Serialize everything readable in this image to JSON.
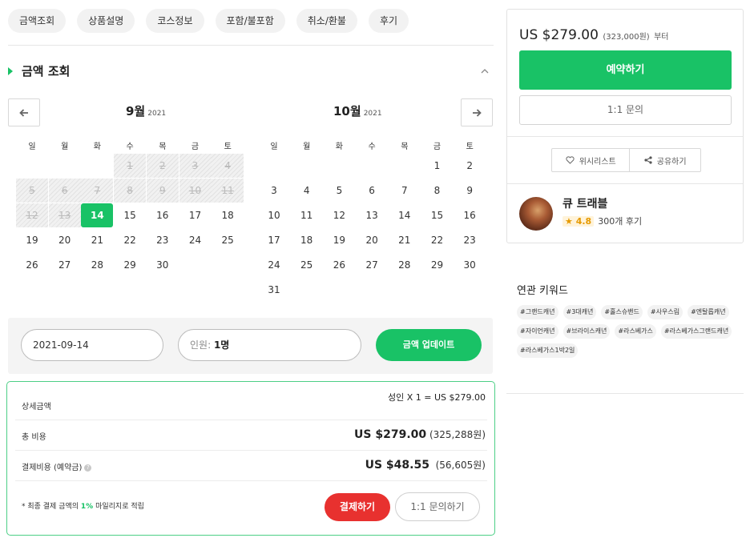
{
  "tabs": [
    "금액조회",
    "상품설명",
    "코스정보",
    "포함/불포함",
    "취소/환불",
    "후기"
  ],
  "section": {
    "title": "금액 조회"
  },
  "calendar": {
    "weekdays": [
      "일",
      "월",
      "화",
      "수",
      "목",
      "금",
      "토"
    ],
    "months": [
      {
        "name": "9월",
        "year": "2021",
        "weeks": [
          [
            "",
            "",
            "",
            "1",
            "2",
            "3",
            "4"
          ],
          [
            "5",
            "6",
            "7",
            "8",
            "9",
            "10",
            "11"
          ],
          [
            "12",
            "13",
            "14",
            "15",
            "16",
            "17",
            "18"
          ],
          [
            "19",
            "20",
            "21",
            "22",
            "23",
            "24",
            "25"
          ],
          [
            "26",
            "27",
            "28",
            "29",
            "30",
            "",
            ""
          ]
        ],
        "past_days": [
          "1",
          "2",
          "3",
          "4",
          "5",
          "6",
          "7",
          "8",
          "9",
          "10",
          "11",
          "12",
          "13"
        ],
        "selected_day": "14"
      },
      {
        "name": "10월",
        "year": "2021",
        "weeks": [
          [
            "",
            "",
            "",
            "",
            "",
            "1",
            "2"
          ],
          [
            "3",
            "4",
            "5",
            "6",
            "7",
            "8",
            "9"
          ],
          [
            "10",
            "11",
            "12",
            "13",
            "14",
            "15",
            "16"
          ],
          [
            "17",
            "18",
            "19",
            "20",
            "21",
            "22",
            "23"
          ],
          [
            "24",
            "25",
            "26",
            "27",
            "28",
            "29",
            "30"
          ],
          [
            "31",
            "",
            "",
            "",
            "",
            "",
            ""
          ]
        ],
        "past_days": [],
        "selected_day": ""
      }
    ]
  },
  "inputs": {
    "date_value": "2021-09-14",
    "people_label": "인원:",
    "people_value": "1명",
    "update_button": "금액 업데이트"
  },
  "price": {
    "detail_label": "상세금액",
    "detail_value": "성인 X 1 = US $279.00",
    "total_label": "총 비용",
    "total_usd": "US $279.00",
    "total_krw": "(325,288원)",
    "deposit_label": "결제비용 (예약금)",
    "deposit_usd": "US $48.55",
    "deposit_krw": "(56,605원)",
    "note_prefix": "* 최종 결제 금액의",
    "note_pct": "1%",
    "note_suffix": "마일리지로 적립",
    "pay_button": "결제하기",
    "inquiry_button": "1:1 문의하기"
  },
  "side": {
    "from_price": "US $279.00",
    "from_krw": "(323,000원)",
    "from_suffix": "부터",
    "book_button": "예약하기",
    "inquiry_button": "1:1 문의",
    "wishlist": "위시리스트",
    "share": "공유하기",
    "seller_name": "큐 트래블",
    "rating": "4.8",
    "reviews": "300개 후기"
  },
  "keywords": {
    "title": "연관 키워드",
    "items": [
      "#그랜드캐년",
      "#3대캐년",
      "#홀스슈밴드",
      "#사우스림",
      "#엔탈롭캐년",
      "#자이언캐년",
      "#브라이스캐년",
      "#라스베가스",
      "#라스베가스그랜드캐년",
      "#라스베가스1박2일"
    ]
  },
  "colors": {
    "accent": "#19c266",
    "danger": "#e8312f"
  }
}
